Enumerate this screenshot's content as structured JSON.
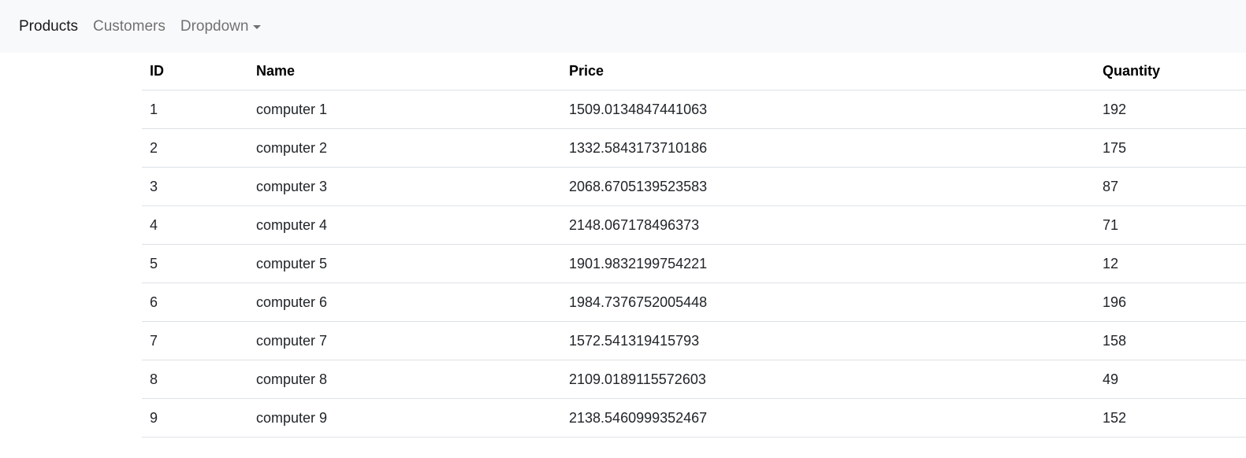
{
  "navbar": {
    "links": [
      {
        "label": "Products"
      },
      {
        "label": "Customers"
      },
      {
        "label": "Dropdown"
      }
    ]
  },
  "table": {
    "headers": {
      "id": "ID",
      "name": "Name",
      "price": "Price",
      "quantity": "Quantity"
    },
    "rows": [
      {
        "id": "1",
        "name": "computer 1",
        "price": "1509.0134847441063",
        "quantity": "192"
      },
      {
        "id": "2",
        "name": "computer 2",
        "price": "1332.5843173710186",
        "quantity": "175"
      },
      {
        "id": "3",
        "name": "computer 3",
        "price": "2068.6705139523583",
        "quantity": "87"
      },
      {
        "id": "4",
        "name": "computer 4",
        "price": "2148.067178496373",
        "quantity": "71"
      },
      {
        "id": "5",
        "name": "computer 5",
        "price": "1901.9832199754221",
        "quantity": "12"
      },
      {
        "id": "6",
        "name": "computer 6",
        "price": "1984.7376752005448",
        "quantity": "196"
      },
      {
        "id": "7",
        "name": "computer 7",
        "price": "1572.541319415793",
        "quantity": "158"
      },
      {
        "id": "8",
        "name": "computer 8",
        "price": "2109.0189115572603",
        "quantity": "49"
      },
      {
        "id": "9",
        "name": "computer 9",
        "price": "2138.5460999352467",
        "quantity": "152"
      }
    ]
  }
}
